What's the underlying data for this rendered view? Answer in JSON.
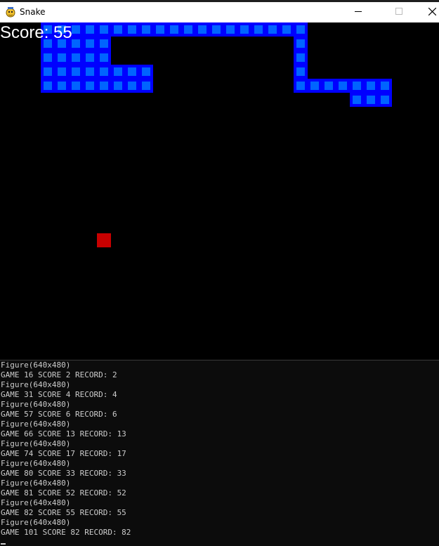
{
  "window": {
    "title": "Snake",
    "icon": "pygame-snake-icon",
    "controls": [
      "minimize-icon",
      "maximize-icon",
      "close-icon"
    ]
  },
  "game": {
    "score_text": "Score: 55",
    "colors": {
      "background": "#000000",
      "snake_outer": "#0000ff",
      "snake_inner": "#0064ff",
      "food": "#c80000",
      "score_text": "#ffffff"
    }
  },
  "console": {
    "lines": [
      "Figure(640x480)",
      "GAME 16 SCORE 2 RECORD: 2",
      "Figure(640x480)",
      "GAME 31 SCORE 4 RECORD: 4",
      "Figure(640x480)",
      "GAME 57 SCORE 6 RECORD: 6",
      "Figure(640x480)",
      "GAME 66 SCORE 13 RECORD: 13",
      "Figure(640x480)",
      "GAME 74 SCORE 17 RECORD: 17",
      "Figure(640x480)",
      "GAME 80 SCORE 33 RECORD: 33",
      "Figure(640x480)",
      "GAME 81 SCORE 52 RECORD: 52",
      "Figure(640x480)",
      "GAME 82 SCORE 55 RECORD: 55",
      "Figure(640x480)",
      "GAME 101 SCORE 82 RECORD: 82"
    ]
  }
}
